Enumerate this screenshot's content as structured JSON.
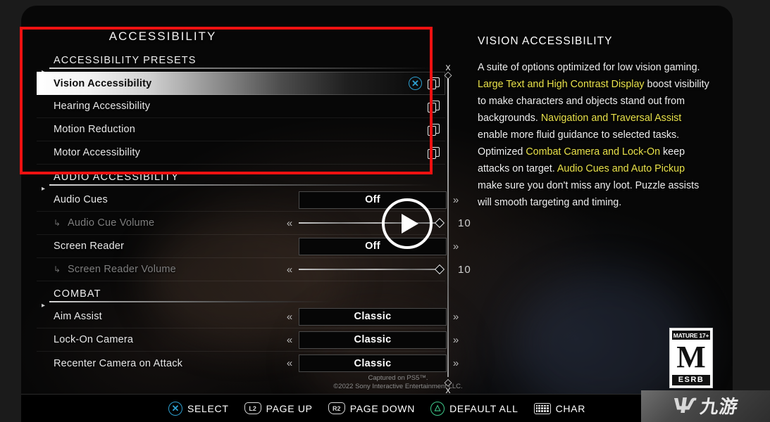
{
  "menu": {
    "title": "ACCESSIBILITY",
    "sections": [
      {
        "id": "presets",
        "heading": "ACCESSIBILITY PRESETS",
        "rows": [
          {
            "label": "Vision Accessibility",
            "selected": true,
            "ps_button": "✕",
            "pages_icon": "pages-icon"
          },
          {
            "label": "Hearing Accessibility",
            "selected": false,
            "pages_icon": "pages-icon"
          },
          {
            "label": "Motion Reduction",
            "selected": false,
            "pages_icon": "pages-icon"
          },
          {
            "label": "Motor Accessibility",
            "selected": false,
            "pages_icon": "pages-icon"
          }
        ]
      },
      {
        "id": "audio",
        "heading": "AUDIO ACCESSIBILITY",
        "rows": [
          {
            "label": "Audio Cues",
            "type": "option",
            "value": "Off",
            "left_arrow": false,
            "right_arrow": true
          },
          {
            "label": "Audio Cue Volume",
            "type": "slider",
            "value": "10",
            "dim": true,
            "left_arrow": true
          },
          {
            "label": "Screen Reader",
            "type": "option",
            "value": "Off",
            "left_arrow": false,
            "right_arrow": true
          },
          {
            "label": "Screen Reader Volume",
            "type": "slider",
            "value": "10",
            "dim": true,
            "left_arrow": true
          }
        ]
      },
      {
        "id": "combat",
        "heading": "COMBAT",
        "rows": [
          {
            "label": "Aim Assist",
            "type": "option",
            "value": "Classic",
            "left_arrow": true,
            "right_arrow": true
          },
          {
            "label": "Lock-On Camera",
            "type": "option",
            "value": "Classic",
            "left_arrow": true,
            "right_arrow": true
          },
          {
            "label": "Recenter Camera on Attack",
            "type": "option",
            "value": "Classic",
            "left_arrow": true,
            "right_arrow": true
          }
        ]
      }
    ]
  },
  "description": {
    "title": "VISION ACCESSIBILITY",
    "segments": [
      {
        "text": "A suite of options optimized for low vision gaming. ",
        "highlight": false
      },
      {
        "text": "Large Text and High Contrast Display",
        "highlight": true
      },
      {
        "text": " boost visibility to make characters and objects stand out from backgrounds. ",
        "highlight": false
      },
      {
        "text": "Navigation and Traversal Assist",
        "highlight": true
      },
      {
        "text": " enable more fluid guidance to selected tasks. Optimized ",
        "highlight": false
      },
      {
        "text": "Combat Camera and Lock-On",
        "highlight": true
      },
      {
        "text": " keep attacks on target. ",
        "highlight": false
      },
      {
        "text": "Audio Cues and Auto Pickup",
        "highlight": true
      },
      {
        "text": " make sure you don't miss any loot. Puzzle assists will smooth targeting and timing.",
        "highlight": false
      }
    ],
    "highlight_color": "#e8e14a"
  },
  "overlay": {
    "play_button": "play-icon",
    "annotation_box_color": "#ee1111"
  },
  "scrollbar": {
    "top_cap": "scroll-up-ornament",
    "bottom_cap": "scroll-down-ornament"
  },
  "esrb": {
    "top_label": "MATURE 17+",
    "rating_letter": "M",
    "bottom_label": "ESRB"
  },
  "credit": {
    "line1": "Captured on PS5™.",
    "line2": "©2022 Sony Interactive Entertainment LLC."
  },
  "prompts": [
    {
      "icon": "ps-cross-button-icon",
      "glyph": "✕",
      "style": "circle-blue",
      "label": "SELECT"
    },
    {
      "icon": "l2-shoulder-button-icon",
      "glyph": "L2",
      "style": "shoulder",
      "label": "PAGE UP"
    },
    {
      "icon": "r2-shoulder-button-icon",
      "glyph": "R2",
      "style": "shoulder",
      "label": "PAGE DOWN"
    },
    {
      "icon": "ps-triangle-button-icon",
      "glyph": "△",
      "style": "circle-green",
      "label": "DEFAULT ALL"
    },
    {
      "icon": "keyboard-icon",
      "glyph": "",
      "style": "keyboard",
      "label": "CHAR"
    }
  ],
  "watermark": {
    "mark": "Ѱ",
    "text": "九游"
  }
}
